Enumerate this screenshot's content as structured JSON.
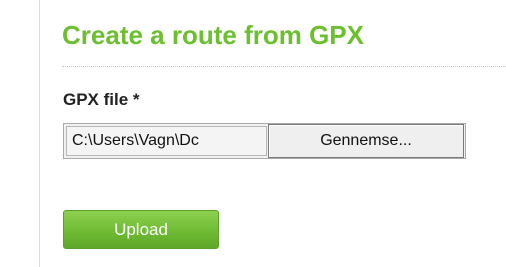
{
  "page": {
    "title": "Create a route from GPX"
  },
  "form": {
    "file_label": "GPX file *",
    "file_path_value": "C:\\Users\\Vagn\\Dc",
    "browse_label": "Gennemse...",
    "upload_label": "Upload"
  },
  "colors": {
    "accent_green": "#6cbf2e",
    "button_green": "#70bb34"
  }
}
